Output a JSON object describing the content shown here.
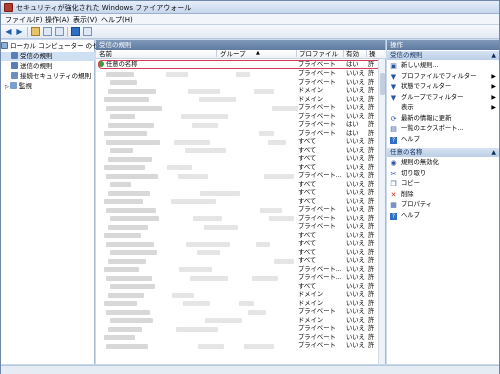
{
  "window": {
    "title": "セキュリティが強化された Windows ファイアウォール"
  },
  "menu": [
    "ファイル(F)",
    "操作(A)",
    "表示(V)",
    "ヘルプ(H)"
  ],
  "tree": {
    "root": "ローカル コンピューター のセ",
    "items": [
      "受信の規則",
      "送信の規則",
      "接続セキュリティの規則",
      "監視"
    ]
  },
  "center": {
    "header": "受信の規則",
    "columns": {
      "name": "名前",
      "group": "グループ",
      "profile": "プロファイル",
      "enabled": "有効",
      "action": "操"
    },
    "first_row": {
      "name": "任意の名称",
      "profile": "プライベート",
      "enabled": "はい",
      "action": "許"
    },
    "rows": [
      {
        "profile": "プライベート",
        "enabled": "いいえ",
        "action": "許"
      },
      {
        "profile": "プライベート",
        "enabled": "いいえ",
        "action": "許"
      },
      {
        "profile": "ドメイン",
        "enabled": "いいえ",
        "action": "許"
      },
      {
        "profile": "ドメイン",
        "enabled": "いいえ",
        "action": "許"
      },
      {
        "profile": "プライベート",
        "enabled": "いいえ",
        "action": "許"
      },
      {
        "profile": "プライベート",
        "enabled": "いいえ",
        "action": "許"
      },
      {
        "profile": "プライベート",
        "enabled": "はい",
        "action": "許"
      },
      {
        "profile": "プライベート",
        "enabled": "はい",
        "action": "許"
      },
      {
        "profile": "すべて",
        "enabled": "いいえ",
        "action": "許"
      },
      {
        "profile": "すべて",
        "enabled": "いいえ",
        "action": "許"
      },
      {
        "profile": "すべて",
        "enabled": "いいえ",
        "action": "許"
      },
      {
        "profile": "すべて",
        "enabled": "いいえ",
        "action": "許"
      },
      {
        "profile": "プライベート...",
        "enabled": "いいえ",
        "action": "許"
      },
      {
        "profile": "すべて",
        "enabled": "いいえ",
        "action": "許"
      },
      {
        "profile": "すべて",
        "enabled": "いいえ",
        "action": "許"
      },
      {
        "profile": "すべて",
        "enabled": "いいえ",
        "action": "許"
      },
      {
        "profile": "プライベート",
        "enabled": "いいえ",
        "action": "許"
      },
      {
        "profile": "プライベート",
        "enabled": "いいえ",
        "action": "許"
      },
      {
        "profile": "プライベート",
        "enabled": "いいえ",
        "action": "許"
      },
      {
        "profile": "すべて",
        "enabled": "いいえ",
        "action": "許"
      },
      {
        "profile": "すべて",
        "enabled": "いいえ",
        "action": "許"
      },
      {
        "profile": "すべて",
        "enabled": "いいえ",
        "action": "許"
      },
      {
        "profile": "すべて",
        "enabled": "いいえ",
        "action": "許"
      },
      {
        "profile": "プライベート...",
        "enabled": "いいえ",
        "action": "許"
      },
      {
        "profile": "プライベート...",
        "enabled": "いいえ",
        "action": "許"
      },
      {
        "profile": "すべて",
        "enabled": "いいえ",
        "action": "許"
      },
      {
        "profile": "ドメイン",
        "enabled": "いいえ",
        "action": "許"
      },
      {
        "profile": "ドメイン",
        "enabled": "いいえ",
        "action": "許"
      },
      {
        "profile": "プライベート",
        "enabled": "いいえ",
        "action": "許"
      },
      {
        "profile": "ドメイン",
        "enabled": "いいえ",
        "action": "許"
      },
      {
        "profile": "プライベート",
        "enabled": "いいえ",
        "action": "許"
      },
      {
        "profile": "プライベート",
        "enabled": "いいえ",
        "action": "許"
      },
      {
        "profile": "プライベート",
        "enabled": "いいえ",
        "action": "許"
      }
    ]
  },
  "actions": {
    "title": "操作",
    "section1": "受信の規則",
    "items1": [
      {
        "icon": "new-rule-icon",
        "label": "新しい規則..."
      },
      {
        "icon": "filter-icon",
        "label": "プロファイルでフィルター",
        "sub": true
      },
      {
        "icon": "filter-icon",
        "label": "状態でフィルター",
        "sub": true
      },
      {
        "icon": "filter-icon",
        "label": "グループでフィルター",
        "sub": true
      },
      {
        "icon": "none",
        "label": "表示",
        "sub": true
      },
      {
        "icon": "refresh-icon",
        "label": "最新の情報に更新"
      },
      {
        "icon": "export-icon",
        "label": "一覧のエクスポート..."
      },
      {
        "icon": "help-icon",
        "label": "ヘルプ"
      }
    ],
    "section2": "任意の名称",
    "items2": [
      {
        "icon": "disable-icon",
        "label": "規則の無効化"
      },
      {
        "icon": "cut-icon",
        "label": "切り取り"
      },
      {
        "icon": "copy-icon",
        "label": "コピー"
      },
      {
        "icon": "delete-icon",
        "label": "削除"
      },
      {
        "icon": "properties-icon",
        "label": "プロパティ"
      },
      {
        "icon": "help-icon",
        "label": "ヘルプ"
      }
    ]
  }
}
